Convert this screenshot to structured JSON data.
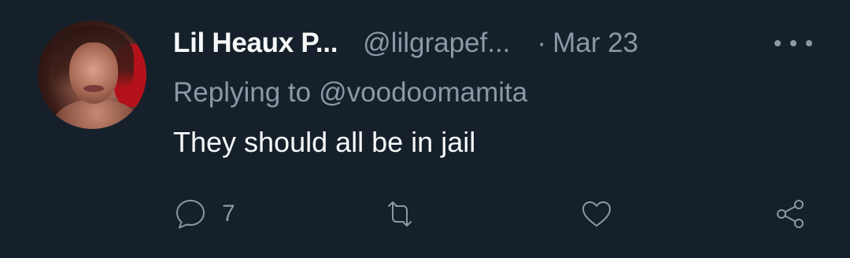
{
  "tweet": {
    "display_name": "Lil Heaux P...",
    "handle": "@lilgrapef...",
    "separator": "·",
    "date": "Mar 23",
    "replying_prefix": "Replying to",
    "replying_target": "@voodoomamita",
    "text": "They should all be in jail"
  },
  "actions": {
    "reply_count": "7",
    "reply_icon": "reply-icon",
    "retweet_icon": "retweet-icon",
    "like_icon": "heart-icon",
    "share_icon": "share-icon"
  },
  "theme": {
    "background": "#15202b",
    "primary_text": "#f7f9f9",
    "secondary_text": "#8b98a5"
  }
}
